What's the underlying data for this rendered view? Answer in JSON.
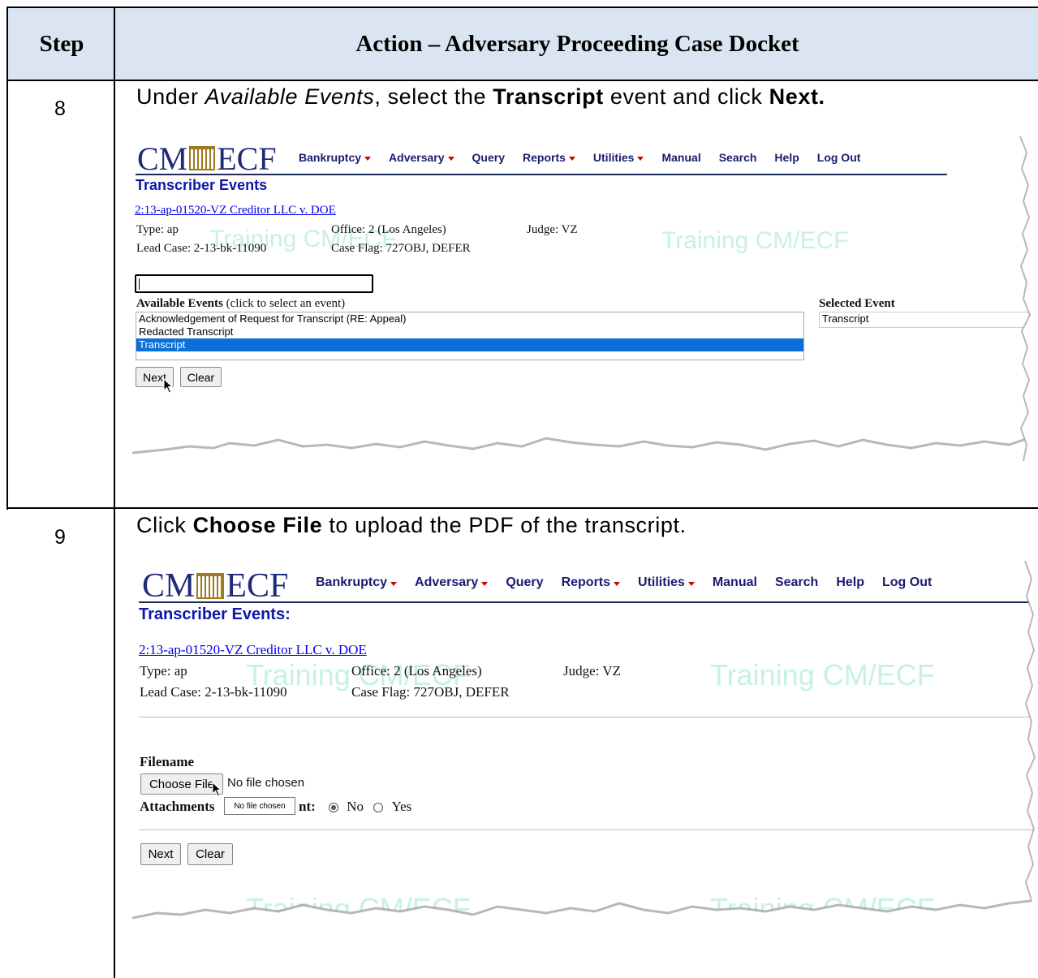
{
  "table": {
    "header_step": "Step",
    "header_action": "Action – Adversary Proceeding Case Docket"
  },
  "rows": [
    {
      "step": "8",
      "instruction": {
        "p1": "Under ",
        "p2": "Available Events",
        "p3": ", select the ",
        "p4": "Transcript",
        "p5": " event and click ",
        "p6": "Next."
      },
      "screen": {
        "logo_left": "CM",
        "logo_right": "ECF",
        "menu": [
          "Bankruptcy",
          "Adversary",
          "Query",
          "Reports",
          "Utilities",
          "Manual",
          "Search",
          "Help",
          "Log Out"
        ],
        "heading": "Transcriber Events",
        "case_link": "2:13-ap-01520-VZ Creditor LLC v. DOE",
        "type": "Type: ap",
        "office": "Office: 2 (Los Angeles)",
        "judge": "Judge: VZ",
        "lead_case": "Lead Case: 2-13-bk-11090",
        "case_flag": "Case Flag: 727OBJ, DEFER",
        "watermark_1": "Training CM/ECF",
        "watermark_2": "Training CM/ECF",
        "available_label_bold": "Available Events",
        "available_label_rest": " (click to select an event)",
        "available_events": [
          "Acknowledgement of Request for Transcript (RE: Appeal)",
          "Redacted Transcript",
          "Transcript"
        ],
        "selected_label": "Selected Event",
        "selected_event": "Transcript",
        "next_button": "Next",
        "clear_button": "Clear"
      }
    },
    {
      "step": "9",
      "instruction": {
        "p1": "Click ",
        "p2": "Choose File",
        "p3": " to upload the PDF of the transcript."
      },
      "screen": {
        "logo_left": "CM",
        "logo_right": "ECF",
        "menu": [
          "Bankruptcy",
          "Adversary",
          "Query",
          "Reports",
          "Utilities",
          "Manual",
          "Search",
          "Help",
          "Log Out"
        ],
        "heading": "Transcriber Events:",
        "case_link": "2:13-ap-01520-VZ Creditor LLC v. DOE",
        "type": "Type: ap",
        "office": "Office: 2 (Los Angeles)",
        "judge": "Judge: VZ",
        "lead_case": "Lead Case: 2-13-bk-11090",
        "case_flag": "Case Flag: 727OBJ, DEFER",
        "watermark_1": "Training CM/ECF",
        "watermark_2": "Training CM/ECF",
        "watermark_3": "Training CM/ECF",
        "watermark_4": "Training CM/ECF",
        "filename_label": "Filename",
        "choose_file_button": "Choose File",
        "no_file_text": "No file chosen",
        "attachments_label_a": "Attachments",
        "attachments_label_b": "nt:",
        "tooltip": "No file chosen",
        "radio_no": "No",
        "radio_yes": "Yes",
        "next_button": "Next",
        "clear_button": "Clear"
      }
    }
  ]
}
